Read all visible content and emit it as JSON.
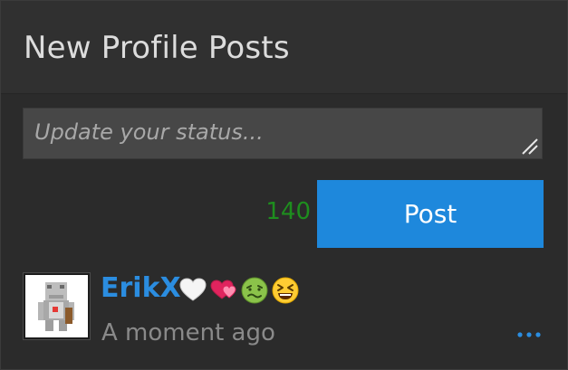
{
  "widget": {
    "title": "New Profile Posts"
  },
  "status_form": {
    "placeholder": "Update your status...",
    "value": "",
    "char_count": "140",
    "post_label": "Post"
  },
  "post": {
    "author": "ErikX",
    "timestamp": "A moment ago",
    "author_badges": [
      "white-heart-icon",
      "heart-exclamation-icon",
      "nauseated-face-icon",
      "squinting-laughing-face-icon"
    ]
  },
  "colors": {
    "background": "#2b2b2b",
    "header": "#303030",
    "accent": "#1e88dc",
    "username": "#2b8de0",
    "counter": "#1e8e1e"
  }
}
